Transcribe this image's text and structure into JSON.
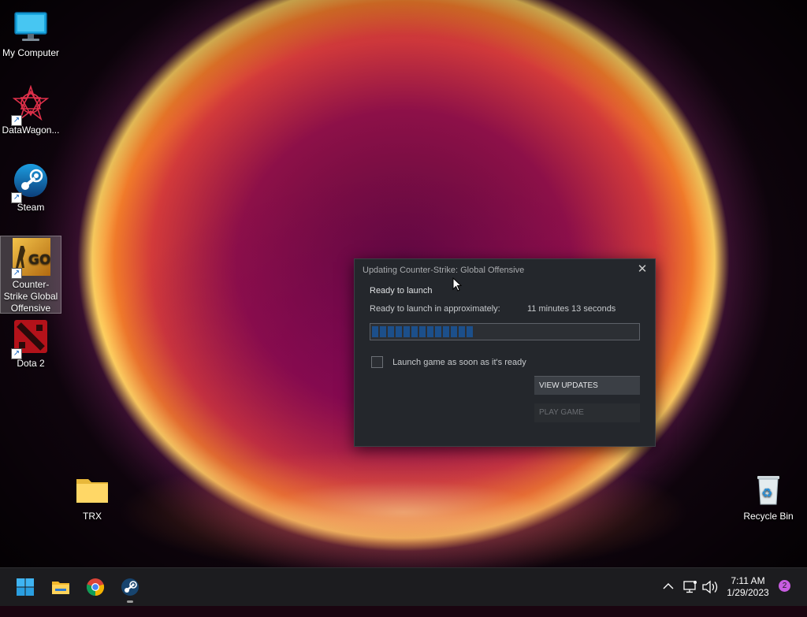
{
  "desktop": {
    "icons": [
      {
        "label": "My Computer",
        "icon": "monitor-icon"
      },
      {
        "label": "DataWagon...",
        "icon": "datawagon-logo-icon"
      },
      {
        "label": "Steam",
        "icon": "steam-icon"
      },
      {
        "label": "Counter-Strike Global Offensive",
        "icon": "csgo-icon"
      },
      {
        "label": "Dota 2",
        "icon": "dota2-icon"
      },
      {
        "label": "TRX",
        "icon": "folder-icon"
      },
      {
        "label": "Recycle Bin",
        "icon": "recycle-bin-icon"
      }
    ]
  },
  "dialog": {
    "title": "Updating Counter-Strike: Global Offensive",
    "status": "Ready to launch",
    "eta_label": "Ready to launch in approximately:",
    "eta_value": "11 minutes 13 seconds",
    "progress": 0.38,
    "checkbox_label": "Launch game as soon as it's ready",
    "checkbox_checked": false,
    "view_updates_label": "VIEW UPDATES",
    "play_game_label": "PLAY GAME",
    "accent_color": "#1c4f8a"
  },
  "taskbar": {
    "apps": [
      "windows-start-icon",
      "file-explorer-icon",
      "chrome-icon",
      "steam-icon"
    ],
    "time": "7:11 AM",
    "date": "1/29/2023",
    "notification_count": "2"
  }
}
